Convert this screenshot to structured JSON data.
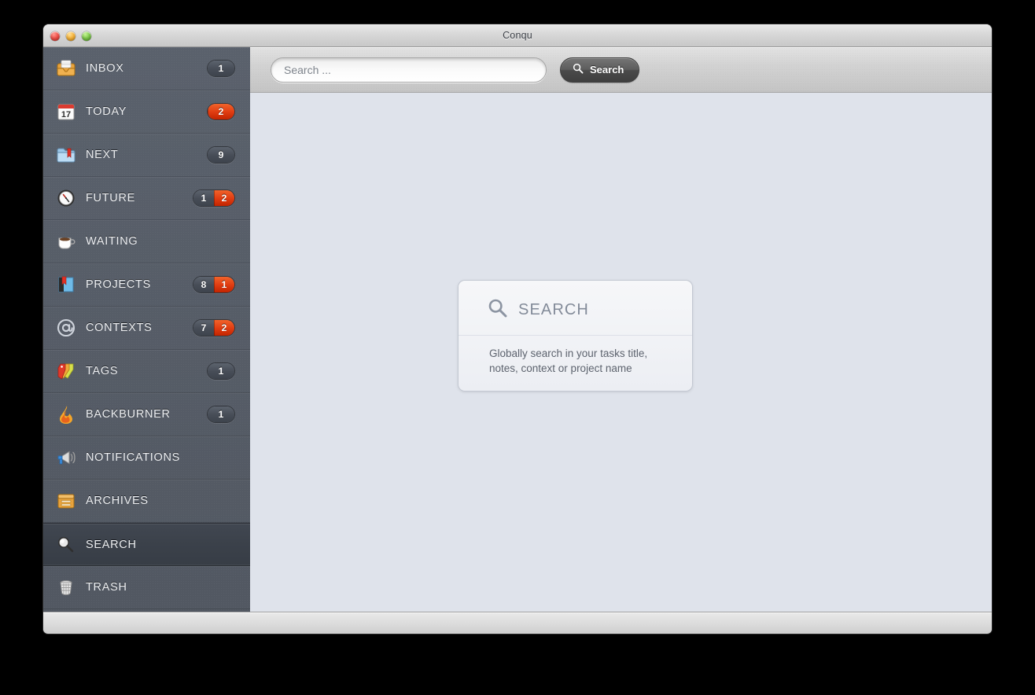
{
  "window": {
    "title": "Conqu",
    "close_label": "close",
    "minimize_label": "minimize",
    "zoom_label": "zoom"
  },
  "toolbar": {
    "search_placeholder": "Search ...",
    "search_value": "",
    "search_button_label": "Search"
  },
  "sidebar": {
    "items": [
      {
        "label": "INBOX",
        "icon": "inbox-tray-icon",
        "badge_count": "1",
        "badge_alert": "",
        "selected": false
      },
      {
        "label": "TODAY",
        "icon": "calendar-icon",
        "badge_count": "",
        "badge_alert": "2",
        "selected": false
      },
      {
        "label": "NEXT",
        "icon": "folder-icon",
        "badge_count": "9",
        "badge_alert": "",
        "selected": false
      },
      {
        "label": "FUTURE",
        "icon": "clock-icon",
        "badge_count": "1",
        "badge_alert": "2",
        "selected": false
      },
      {
        "label": "WAITING",
        "icon": "coffee-cup-icon",
        "badge_count": "",
        "badge_alert": "",
        "selected": false
      },
      {
        "label": "PROJECTS",
        "icon": "book-icon",
        "badge_count": "8",
        "badge_alert": "1",
        "selected": false
      },
      {
        "label": "CONTEXTS",
        "icon": "at-sign-icon",
        "badge_count": "7",
        "badge_alert": "2",
        "selected": false
      },
      {
        "label": "TAGS",
        "icon": "tags-icon",
        "badge_count": "1",
        "badge_alert": "",
        "selected": false
      },
      {
        "label": "BACKBURNER",
        "icon": "flame-icon",
        "badge_count": "1",
        "badge_alert": "",
        "selected": false
      },
      {
        "label": "NOTIFICATIONS",
        "icon": "megaphone-icon",
        "badge_count": "",
        "badge_alert": "",
        "selected": false
      },
      {
        "label": "ARCHIVES",
        "icon": "archive-box-icon",
        "badge_count": "",
        "badge_alert": "",
        "selected": false
      },
      {
        "label": "SEARCH",
        "icon": "magnifier-icon",
        "badge_count": "",
        "badge_alert": "",
        "selected": true
      },
      {
        "label": "TRASH",
        "icon": "trash-can-icon",
        "badge_count": "",
        "badge_alert": "",
        "selected": false
      }
    ]
  },
  "main": {
    "card": {
      "icon": "magnifier-icon",
      "title": "SEARCH",
      "description_line1": "Globally search in your tasks title,",
      "description_line2": "notes, context or project name"
    }
  },
  "colors": {
    "sidebar_bg": "#555c67",
    "sidebar_selected": "#3b414a",
    "content_bg": "#dfe3eb",
    "badge_alert": "#e03d12",
    "badge_neutral": "#474d57",
    "toolbar_bg": "#d3d3d3",
    "titlebar_bg": "#d7d7d7",
    "card_bg": "#f2f4f7",
    "card_title_text": "#838b99"
  }
}
